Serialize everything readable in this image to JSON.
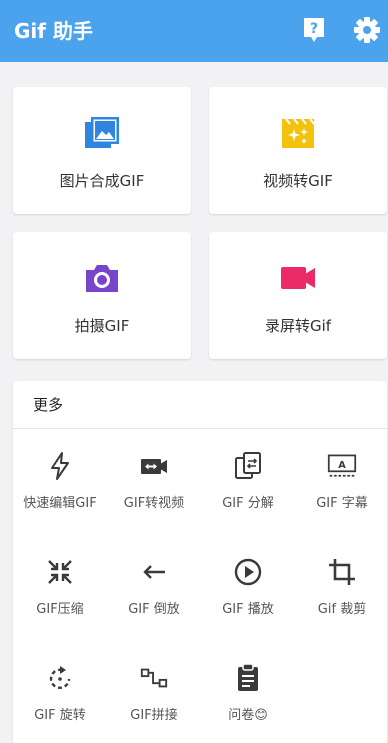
{
  "app": {
    "title": "Gif 助手"
  },
  "colors": {
    "appbar": "#4ba3ee",
    "image_icon": "#2f86de",
    "video_icon": "#f4c20d",
    "camera_icon": "#7645c9",
    "record_icon": "#ea2b68",
    "tool_icon": "#3a3a3a"
  },
  "toolbar": {
    "help_icon": "help-icon",
    "settings_icon": "settings-icon"
  },
  "cards": [
    {
      "label": "图片合成GIF",
      "icon": "image-icon"
    },
    {
      "label": "视频转GIF",
      "icon": "video-icon"
    },
    {
      "label": "拍摄GIF",
      "icon": "camera-icon"
    },
    {
      "label": "录屏转Gif",
      "icon": "record-video-icon"
    }
  ],
  "more": {
    "title": "更多",
    "tools": [
      {
        "label": "快速编辑GIF",
        "icon": "flash-icon"
      },
      {
        "label": "GIF转视频",
        "icon": "convert-video-icon"
      },
      {
        "label": "GIF 分解",
        "icon": "split-icon"
      },
      {
        "label": "GIF 字幕",
        "icon": "subtitle-icon"
      },
      {
        "label": "GIF压缩",
        "icon": "compress-icon"
      },
      {
        "label": "GIF 倒放",
        "icon": "reverse-icon"
      },
      {
        "label": "GIF 播放",
        "icon": "play-icon"
      },
      {
        "label": "Gif 裁剪",
        "icon": "crop-icon"
      },
      {
        "label": "GIF 旋转",
        "icon": "rotate-icon"
      },
      {
        "label": "GIF拼接",
        "icon": "join-icon"
      },
      {
        "label": "问卷😊",
        "icon": "survey-icon"
      }
    ]
  }
}
